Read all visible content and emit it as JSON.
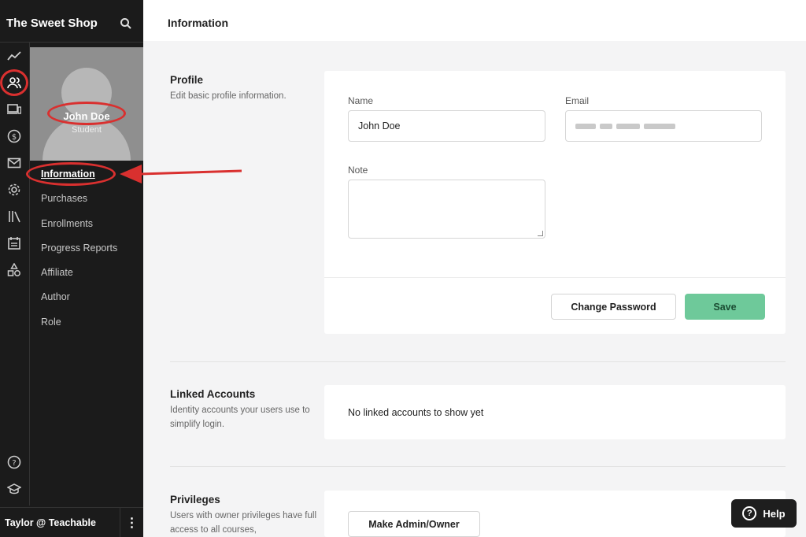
{
  "app": {
    "school_name": "The Sweet Shop"
  },
  "user": {
    "name": "John Doe",
    "role": "Student"
  },
  "sidebar": {
    "nav": [
      {
        "label": "Information",
        "active": true
      },
      {
        "label": "Purchases"
      },
      {
        "label": "Enrollments"
      },
      {
        "label": "Progress Reports"
      },
      {
        "label": "Affiliate"
      },
      {
        "label": "Author"
      },
      {
        "label": "Role"
      }
    ],
    "icons": [
      "trend-icon",
      "users-icon",
      "devices-icon",
      "dollar-icon",
      "mail-icon",
      "gear-icon",
      "library-icon",
      "calendar-icon",
      "shapes-icon",
      "help-circle-icon",
      "graduation-cap-icon"
    ],
    "account_label": "Taylor @ Teachable",
    "menu_glyph": "⋮"
  },
  "page": {
    "title": "Information"
  },
  "profile": {
    "title": "Profile",
    "description": "Edit basic profile information.",
    "name_label": "Name",
    "name_value": "John Doe",
    "email_label": "Email",
    "note_label": "Note",
    "change_password_label": "Change Password",
    "save_label": "Save"
  },
  "linked_accounts": {
    "title": "Linked Accounts",
    "description": "Identity accounts your users use to simplify login.",
    "empty_text": "No linked accounts to show yet"
  },
  "privileges": {
    "title": "Privileges",
    "description": "Users with owner privileges have full access to all courses,",
    "make_admin_label": "Make Admin/Owner"
  },
  "help": {
    "label": "Help",
    "icon_glyph": "?"
  },
  "colors": {
    "sidebar_bg": "#1b1b1b",
    "save_green": "#6ec99a",
    "annotation_red": "#d9302f"
  }
}
